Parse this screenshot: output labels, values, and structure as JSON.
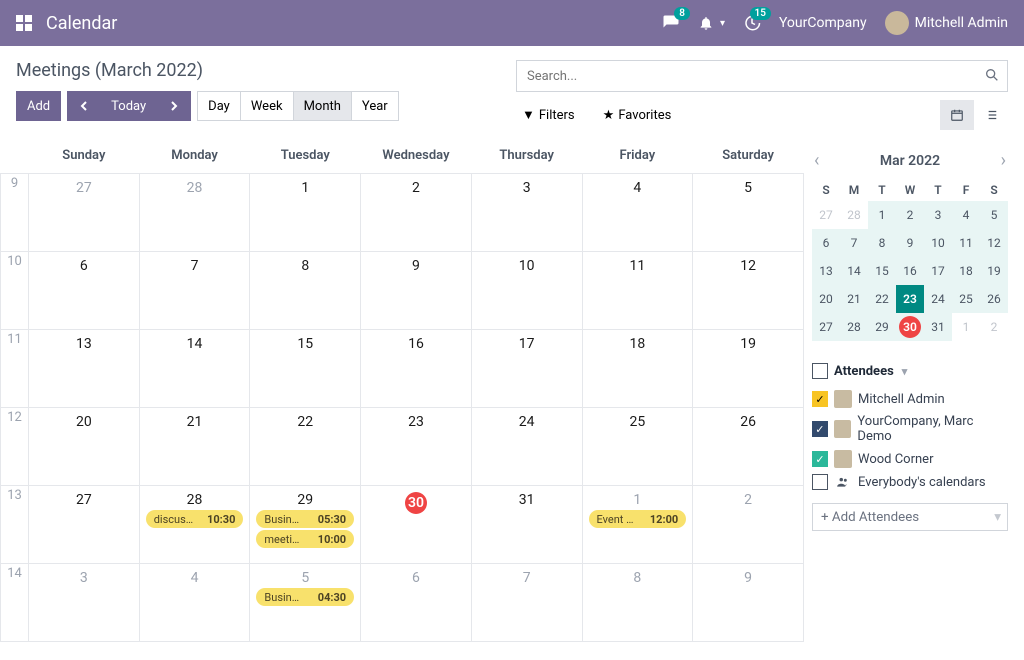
{
  "header": {
    "brand": "Calendar",
    "messages_badge": "8",
    "activity_badge": "15",
    "company": "YourCompany",
    "user": "Mitchell Admin"
  },
  "toolbar": {
    "title": "Meetings (March 2022)",
    "add": "Add",
    "today": "Today",
    "view_day": "Day",
    "view_week": "Week",
    "view_month": "Month",
    "view_year": "Year",
    "search_placeholder": "Search...",
    "filters": "Filters",
    "favorites": "Favorites"
  },
  "calendar": {
    "dow": [
      "Sunday",
      "Monday",
      "Tuesday",
      "Wednesday",
      "Thursday",
      "Friday",
      "Saturday"
    ],
    "weeks": [
      {
        "wk": "9",
        "days": [
          {
            "n": "27",
            "out": true
          },
          {
            "n": "28",
            "out": true
          },
          {
            "n": "1"
          },
          {
            "n": "2"
          },
          {
            "n": "3"
          },
          {
            "n": "4"
          },
          {
            "n": "5"
          }
        ]
      },
      {
        "wk": "10",
        "days": [
          {
            "n": "6"
          },
          {
            "n": "7"
          },
          {
            "n": "8"
          },
          {
            "n": "9"
          },
          {
            "n": "10"
          },
          {
            "n": "11"
          },
          {
            "n": "12"
          }
        ]
      },
      {
        "wk": "11",
        "days": [
          {
            "n": "13"
          },
          {
            "n": "14"
          },
          {
            "n": "15"
          },
          {
            "n": "16"
          },
          {
            "n": "17"
          },
          {
            "n": "18"
          },
          {
            "n": "19"
          }
        ]
      },
      {
        "wk": "12",
        "days": [
          {
            "n": "20"
          },
          {
            "n": "21"
          },
          {
            "n": "22"
          },
          {
            "n": "23"
          },
          {
            "n": "24"
          },
          {
            "n": "25"
          },
          {
            "n": "26"
          }
        ]
      },
      {
        "wk": "13",
        "days": [
          {
            "n": "27"
          },
          {
            "n": "28",
            "events": [
              {
                "label": "discus…",
                "time": "10:30"
              }
            ]
          },
          {
            "n": "29",
            "events": [
              {
                "label": "Busin…",
                "time": "05:30"
              },
              {
                "label": "meeti…",
                "time": "10:00"
              }
            ]
          },
          {
            "n": "30",
            "today": true
          },
          {
            "n": "31"
          },
          {
            "n": "1",
            "out": true,
            "events": [
              {
                "label": "Event …",
                "time": "12:00"
              }
            ]
          },
          {
            "n": "2",
            "out": true
          }
        ]
      },
      {
        "wk": "14",
        "days": [
          {
            "n": "3",
            "out": true
          },
          {
            "n": "4",
            "out": true
          },
          {
            "n": "5",
            "out": true,
            "events": [
              {
                "label": "Busin…",
                "time": "04:30"
              }
            ]
          },
          {
            "n": "6",
            "out": true
          },
          {
            "n": "7",
            "out": true
          },
          {
            "n": "8",
            "out": true
          },
          {
            "n": "9",
            "out": true
          }
        ]
      }
    ]
  },
  "mini": {
    "title": "Mar 2022",
    "dow": [
      "S",
      "M",
      "T",
      "W",
      "T",
      "F",
      "S"
    ],
    "rows": [
      [
        {
          "n": "27",
          "out": true
        },
        {
          "n": "28",
          "out": true
        },
        {
          "n": "1",
          "in": true
        },
        {
          "n": "2",
          "in": true
        },
        {
          "n": "3",
          "in": true
        },
        {
          "n": "4",
          "in": true
        },
        {
          "n": "5",
          "in": true
        }
      ],
      [
        {
          "n": "6",
          "in": true
        },
        {
          "n": "7",
          "in": true
        },
        {
          "n": "8",
          "in": true
        },
        {
          "n": "9",
          "in": true
        },
        {
          "n": "10",
          "in": true
        },
        {
          "n": "11",
          "in": true
        },
        {
          "n": "12",
          "in": true
        }
      ],
      [
        {
          "n": "13",
          "in": true
        },
        {
          "n": "14",
          "in": true
        },
        {
          "n": "15",
          "in": true
        },
        {
          "n": "16",
          "in": true
        },
        {
          "n": "17",
          "in": true
        },
        {
          "n": "18",
          "in": true
        },
        {
          "n": "19",
          "in": true
        }
      ],
      [
        {
          "n": "20",
          "in": true
        },
        {
          "n": "21",
          "in": true
        },
        {
          "n": "22",
          "in": true
        },
        {
          "n": "23",
          "in": true,
          "sel": true
        },
        {
          "n": "24",
          "in": true
        },
        {
          "n": "25",
          "in": true
        },
        {
          "n": "26",
          "in": true
        }
      ],
      [
        {
          "n": "27",
          "in": true
        },
        {
          "n": "28",
          "in": true
        },
        {
          "n": "29",
          "in": true
        },
        {
          "n": "30",
          "in": true,
          "today": true
        },
        {
          "n": "31",
          "in": true
        },
        {
          "n": "1",
          "out": true
        },
        {
          "n": "2",
          "out": true
        }
      ]
    ]
  },
  "attendees": {
    "title": "Attendees",
    "rows": [
      {
        "name": "Mitchell Admin",
        "color": "yellow",
        "checked": true,
        "avatar": true
      },
      {
        "name": "YourCompany, Marc Demo",
        "color": "navy",
        "checked": true,
        "avatar": true
      },
      {
        "name": "Wood Corner",
        "color": "green",
        "checked": true,
        "avatar": true
      },
      {
        "name": "Everybody's calendars",
        "color": "",
        "checked": false,
        "groupicon": true
      }
    ],
    "add": "+ Add Attendees"
  }
}
